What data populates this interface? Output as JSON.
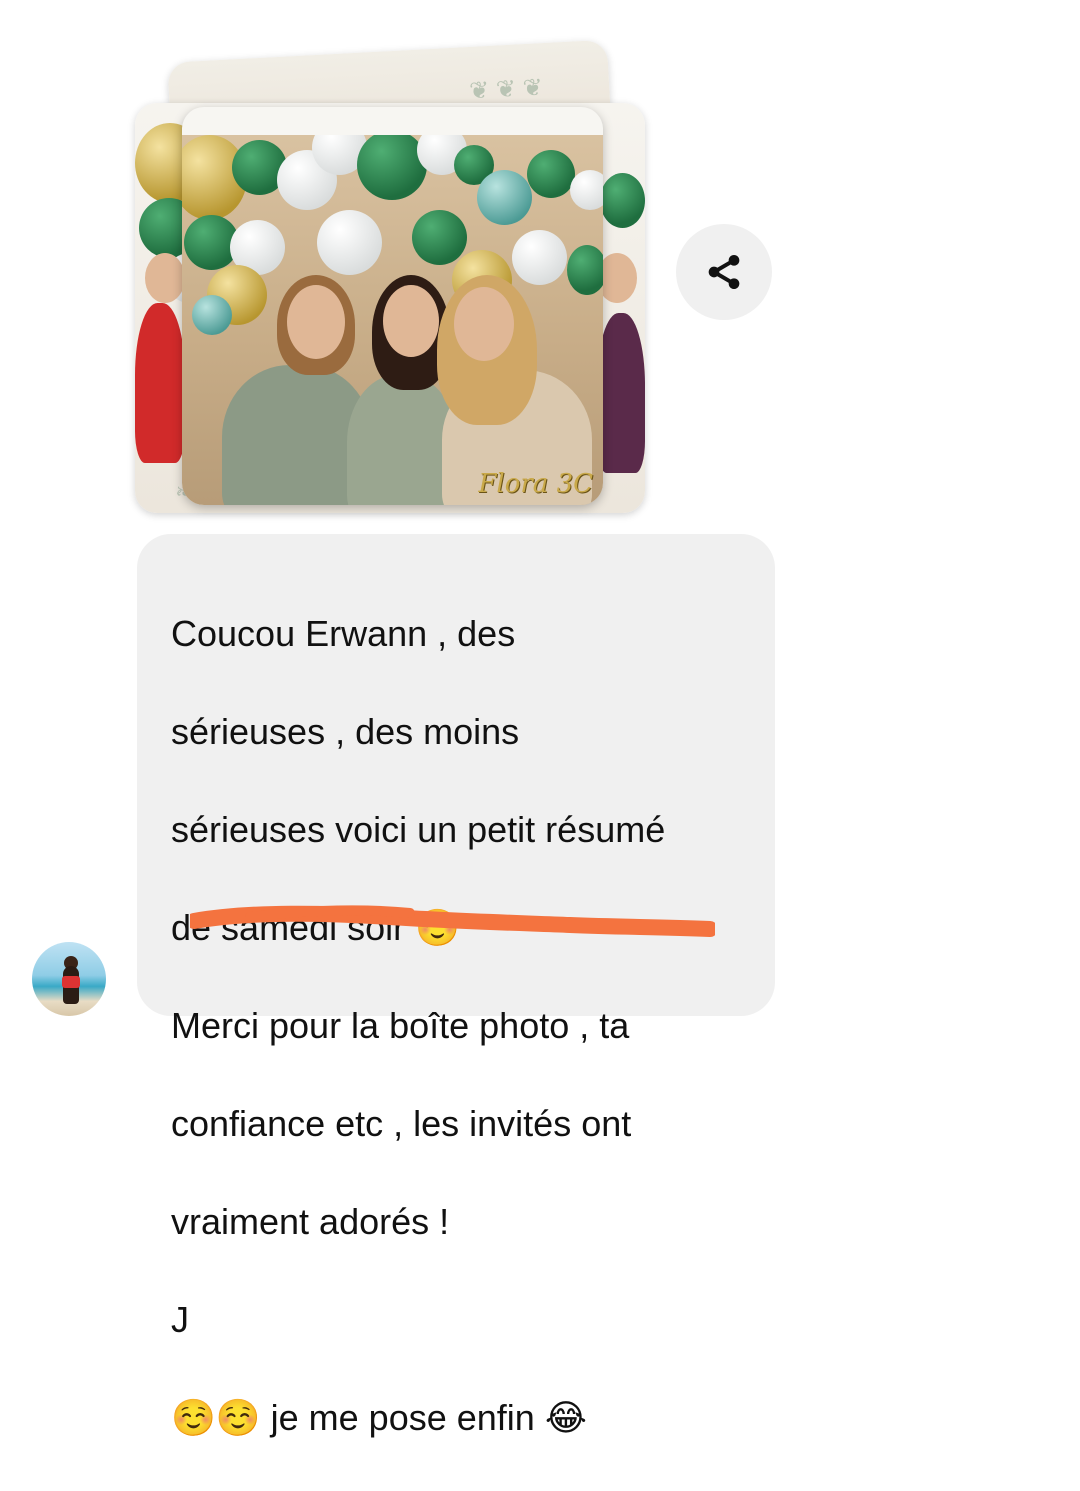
{
  "photo_album": {
    "watermark": "Flora 3C"
  },
  "share": {
    "icon": "share-icon"
  },
  "message": {
    "lines": [
      "Coucou Erwann , des",
      "sérieuses , des moins",
      "sérieuses voici un petit résumé",
      "de samedi soir ☺️",
      "Merci pour la boîte photo , ta",
      "confiance etc , les invités ont",
      "vraiment adorés !",
      "J",
      "☺️☺️ je me pose enfin 😂"
    ],
    "redaction_color": "#f4733f",
    "bubble_color": "#f0f0f0"
  },
  "avatar": {
    "icon": "avatar"
  }
}
